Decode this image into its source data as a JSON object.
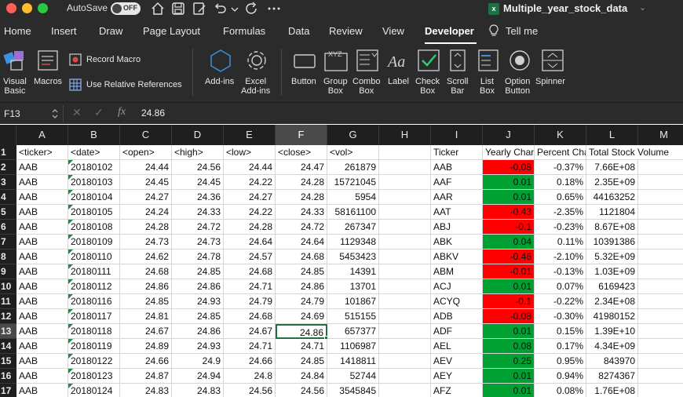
{
  "titlebar": {
    "autosave_label": "AutoSave",
    "autosave_state": "OFF",
    "document_title": "Multiple_year_stock_data"
  },
  "tabs": [
    "Home",
    "Insert",
    "Draw",
    "Page Layout",
    "Formulas",
    "Data",
    "Review",
    "View",
    "Developer",
    "Tell me"
  ],
  "active_tab": "Developer",
  "ribbon": {
    "visual_basic": "Visual\nBasic",
    "macros": "Macros",
    "record_macro": "Record Macro",
    "relative_refs": "Use Relative References",
    "add_ins": "Add-ins",
    "excel_add_ins": "Excel\nAdd-ins",
    "button": "Button",
    "group_box": "Group\nBox",
    "combo_box": "Combo\nBox",
    "label": "Label",
    "check_box": "Check\nBox",
    "scroll_bar": "Scroll\nBar",
    "list_box": "List\nBox",
    "option_button": "Option\nButton",
    "spinner": "Spinner"
  },
  "formula_bar": {
    "cell_ref": "F13",
    "fx": "fx",
    "value": "24.86"
  },
  "columns": [
    "A",
    "B",
    "C",
    "D",
    "E",
    "F",
    "G",
    "H",
    "I",
    "J",
    "K",
    "L",
    "M"
  ],
  "selected_column": "F",
  "selected_row": "13",
  "rows": [
    {
      "n": "1",
      "A": "<ticker>",
      "B": "<date>",
      "C": "<open>",
      "D": "<high>",
      "E": "<low>",
      "F": "<close>",
      "G": "<vol>",
      "I": "Ticker",
      "J": "Yearly Change",
      "K": "Percent Change",
      "L": "Total Stock Volume",
      "M": ""
    },
    {
      "n": "2",
      "A": "AAB",
      "B": "20180102",
      "C": "24.44",
      "D": "24.56",
      "E": "24.44",
      "F": "24.47",
      "G": "261879",
      "I": "AAB",
      "J": "-0.08",
      "K": "-0.37%",
      "L": "7.66E+08",
      "Jc": "red"
    },
    {
      "n": "3",
      "A": "AAB",
      "B": "20180103",
      "C": "24.45",
      "D": "24.45",
      "E": "24.22",
      "F": "24.28",
      "G": "15721045",
      "I": "AAF",
      "J": "0.01",
      "K": "0.18%",
      "L": "2.35E+09",
      "Jc": "green"
    },
    {
      "n": "4",
      "A": "AAB",
      "B": "20180104",
      "C": "24.27",
      "D": "24.36",
      "E": "24.27",
      "F": "24.28",
      "G": "5954",
      "I": "AAR",
      "J": "0.01",
      "K": "0.65%",
      "L": "44163252",
      "Jc": "green"
    },
    {
      "n": "5",
      "A": "AAB",
      "B": "20180105",
      "C": "24.24",
      "D": "24.33",
      "E": "24.22",
      "F": "24.33",
      "G": "58161100",
      "I": "AAT",
      "J": "-0.43",
      "K": "-2.35%",
      "L": "1121804",
      "Jc": "red"
    },
    {
      "n": "6",
      "A": "AAB",
      "B": "20180108",
      "C": "24.28",
      "D": "24.72",
      "E": "24.28",
      "F": "24.72",
      "G": "267347",
      "I": "ABJ",
      "J": "-0.1",
      "K": "-0.23%",
      "L": "8.67E+08",
      "Jc": "red"
    },
    {
      "n": "7",
      "A": "AAB",
      "B": "20180109",
      "C": "24.73",
      "D": "24.73",
      "E": "24.64",
      "F": "24.64",
      "G": "1129348",
      "I": "ABK",
      "J": "0.04",
      "K": "0.11%",
      "L": "10391386",
      "Jc": "green"
    },
    {
      "n": "8",
      "A": "AAB",
      "B": "20180110",
      "C": "24.62",
      "D": "24.78",
      "E": "24.57",
      "F": "24.68",
      "G": "5453423",
      "I": "ABKV",
      "J": "-0.46",
      "K": "-2.10%",
      "L": "5.32E+09",
      "Jc": "red"
    },
    {
      "n": "9",
      "A": "AAB",
      "B": "20180111",
      "C": "24.68",
      "D": "24.85",
      "E": "24.68",
      "F": "24.85",
      "G": "14391",
      "I": "ABM",
      "J": "-0.01",
      "K": "-0.13%",
      "L": "1.03E+09",
      "Jc": "red"
    },
    {
      "n": "10",
      "A": "AAB",
      "B": "20180112",
      "C": "24.86",
      "D": "24.86",
      "E": "24.71",
      "F": "24.86",
      "G": "13701",
      "I": "ACJ",
      "J": "0.01",
      "K": "0.07%",
      "L": "6169423",
      "Jc": "green"
    },
    {
      "n": "11",
      "A": "AAB",
      "B": "20180116",
      "C": "24.85",
      "D": "24.93",
      "E": "24.79",
      "F": "24.79",
      "G": "101867",
      "I": "ACYQ",
      "J": "-0.1",
      "K": "-0.22%",
      "L": "2.34E+08",
      "Jc": "red"
    },
    {
      "n": "12",
      "A": "AAB",
      "B": "20180117",
      "C": "24.81",
      "D": "24.85",
      "E": "24.68",
      "F": "24.69",
      "G": "515155",
      "I": "ADB",
      "J": "-0.08",
      "K": "-0.30%",
      "L": "41980152",
      "Jc": "red"
    },
    {
      "n": "13",
      "A": "AAB",
      "B": "20180118",
      "C": "24.67",
      "D": "24.86",
      "E": "24.67",
      "F": "24.86",
      "G": "657377",
      "I": "ADF",
      "J": "0.01",
      "K": "0.15%",
      "L": "1.39E+10",
      "Jc": "green"
    },
    {
      "n": "14",
      "A": "AAB",
      "B": "20180119",
      "C": "24.89",
      "D": "24.93",
      "E": "24.71",
      "F": "24.71",
      "G": "1106987",
      "I": "AEL",
      "J": "0.08",
      "K": "0.17%",
      "L": "4.34E+09",
      "Jc": "green"
    },
    {
      "n": "15",
      "A": "AAB",
      "B": "20180122",
      "C": "24.66",
      "D": "24.9",
      "E": "24.66",
      "F": "24.85",
      "G": "1418811",
      "I": "AEV",
      "J": "0.25",
      "K": "0.95%",
      "L": "843970",
      "Jc": "green"
    },
    {
      "n": "16",
      "A": "AAB",
      "B": "20180123",
      "C": "24.87",
      "D": "24.94",
      "E": "24.8",
      "F": "24.84",
      "G": "52744",
      "I": "AEY",
      "J": "0.01",
      "K": "0.94%",
      "L": "8274367",
      "Jc": "green"
    },
    {
      "n": "17",
      "A": "AAB",
      "B": "20180124",
      "C": "24.83",
      "D": "24.83",
      "E": "24.56",
      "F": "24.56",
      "G": "3545845",
      "I": "AFZ",
      "J": "0.01",
      "K": "0.08%",
      "L": "1.76E+08",
      "Jc": "green"
    }
  ]
}
